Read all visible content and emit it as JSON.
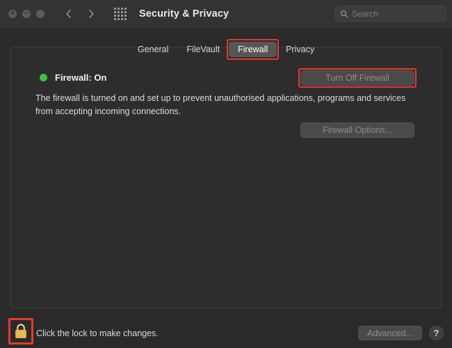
{
  "window": {
    "title": "Security & Privacy",
    "traffic_lights": [
      {
        "name": "close-button",
        "glyph": "✕"
      },
      {
        "name": "minimize-button",
        "glyph": "−"
      },
      {
        "name": "zoom-button",
        "glyph": ""
      }
    ],
    "nav": {
      "back_label": "Back",
      "forward_label": "Forward",
      "show_all_label": "Show All"
    }
  },
  "search": {
    "placeholder": "Search",
    "value": "",
    "icon": "search-icon"
  },
  "tabs": [
    {
      "label": "General",
      "selected": false,
      "annotated": false
    },
    {
      "label": "FileVault",
      "selected": false,
      "annotated": false
    },
    {
      "label": "Firewall",
      "selected": true,
      "annotated": true
    },
    {
      "label": "Privacy",
      "selected": false,
      "annotated": false
    }
  ],
  "firewall": {
    "status_label": "Firewall: On",
    "status_color": "#3ac23a",
    "description": "The firewall is turned on and set up to prevent unauthorised applications, programs and services from accepting incoming connections.",
    "turn_off_label": "Turn Off Firewall",
    "options_label": "Firewall Options...",
    "annotation_color": "#e8392a"
  },
  "footer": {
    "lock_icon": "lock-closed-icon",
    "lock_hint": "Click the lock to make changes.",
    "advanced_label": "Advanced...",
    "help_label": "?"
  }
}
